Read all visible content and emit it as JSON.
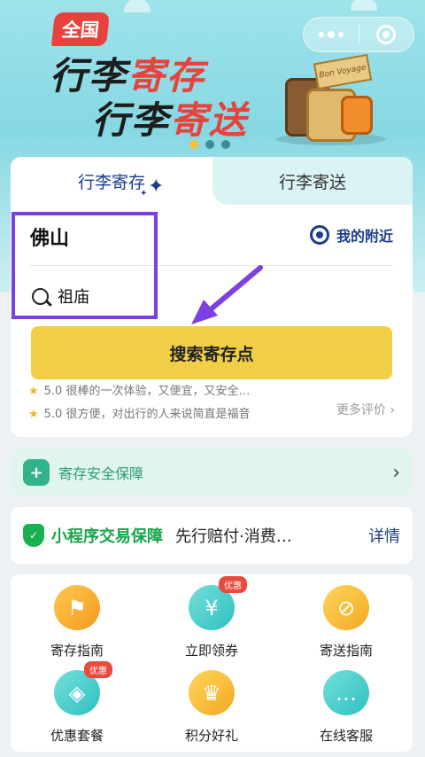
{
  "banner": {
    "badge": "全国",
    "line1": {
      "dark": "行李",
      "red": "寄存"
    },
    "line2": {
      "dark": "行李",
      "red": "寄送"
    },
    "sign_text": "Bon Voyage"
  },
  "tabs": [
    {
      "label": "行李寄存",
      "active": true
    },
    {
      "label": "行李寄送",
      "active": false
    }
  ],
  "search": {
    "city": "佛山",
    "nearby_label": "我的附近",
    "query": "祖庙",
    "button_label": "搜索寄存点"
  },
  "reviews": {
    "items": [
      {
        "score": "5.0",
        "text": "很棒的一次体验，又便宜，又安全…"
      },
      {
        "score": "5.0",
        "text": "很方便，对出行的人来说简直是福音"
      }
    ],
    "more_label": "更多评价"
  },
  "safety": {
    "label": "寄存安全保障"
  },
  "guarantee": {
    "title": "小程序交易保障",
    "desc": "先行赔付·消费…",
    "detail": "详情"
  },
  "services": [
    {
      "label": "寄存指南",
      "icon": "signpost-icon",
      "color": "orange",
      "badge": ""
    },
    {
      "label": "立即领券",
      "icon": "coupon-icon",
      "color": "teal",
      "badge": "优惠"
    },
    {
      "label": "寄送指南",
      "icon": "compass-icon",
      "color": "yellow",
      "badge": ""
    },
    {
      "label": "优惠套餐",
      "icon": "tag-icon",
      "color": "teal",
      "badge": "优惠"
    },
    {
      "label": "积分好礼",
      "icon": "crown-icon",
      "color": "yellow",
      "badge": ""
    },
    {
      "label": "在线客服",
      "icon": "chat-icon",
      "color": "teal",
      "badge": ""
    }
  ],
  "colors": {
    "primary_blue": "#1a3e8c",
    "accent_yellow": "#f1ce45",
    "banner_red": "#e8423c",
    "highlight_purple": "#7b3fe4",
    "green": "#17a54a"
  }
}
